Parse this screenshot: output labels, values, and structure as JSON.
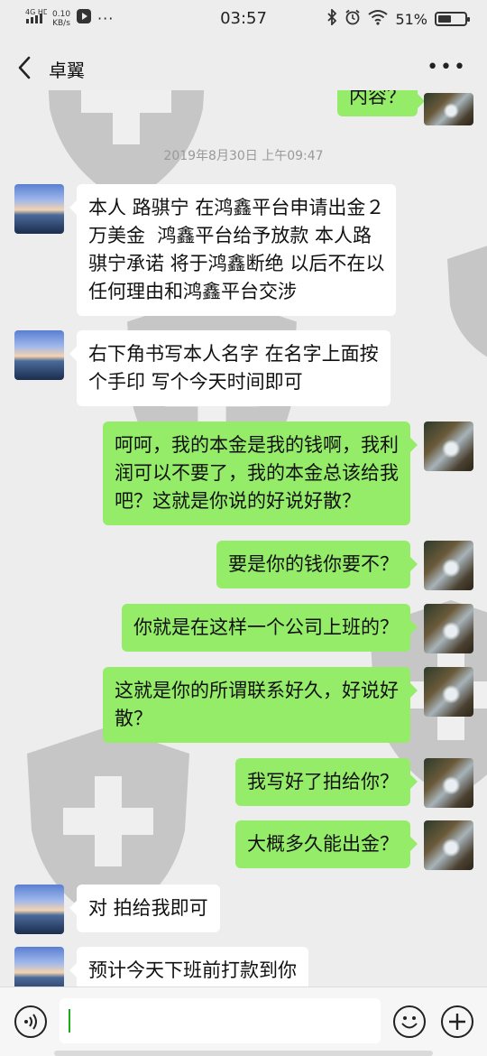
{
  "status_bar": {
    "network": "4G HD",
    "speed_value": "0.10",
    "speed_unit": "KB/s",
    "time": "03:57",
    "battery_text": "51%",
    "battery_level": 0.51
  },
  "header": {
    "title": "卓翼",
    "back_icon": "back-chevron-icon",
    "more_icon": "more-dots-icon"
  },
  "chat": {
    "partial_top_message": "内容？",
    "timestamp": "2019年8月30日 上午09:47",
    "messages": [
      {
        "side": "in",
        "lines": [
          "本人 路骐宁 在鸿鑫平台申请出金２",
          "万美金  鸿鑫平台给予放款 本人路",
          "骐宁承诺 将于鸿鑫断绝 以后不在以",
          "任何理由和鸿鑫平台交涉"
        ]
      },
      {
        "side": "in",
        "lines": [
          "右下角书写本人名字 在名字上面按",
          "个手印 写个今天时间即可"
        ]
      },
      {
        "side": "out",
        "lines": [
          "呵呵，我的本金是我的钱啊，我利",
          "润可以不要了，我的本金总该给我",
          "吧？这就是你说的好说好散？"
        ]
      },
      {
        "side": "out",
        "lines": [
          "要是你的钱你要不？"
        ]
      },
      {
        "side": "out",
        "lines": [
          "你就是在这样一个公司上班的？"
        ]
      },
      {
        "side": "out",
        "lines": [
          "这就是你的所谓联系好久，好说好",
          "散？"
        ]
      },
      {
        "side": "out",
        "lines": [
          "我写好了拍给你？"
        ]
      },
      {
        "side": "out",
        "lines": [
          "大概多久能出金？"
        ]
      },
      {
        "side": "in",
        "lines": [
          "对 拍给我即可"
        ]
      },
      {
        "side": "in",
        "lines": [
          "预计今天下班前打款到你"
        ]
      }
    ]
  },
  "input_bar": {
    "voice_icon": "voice-icon",
    "emoji_icon": "emoji-icon",
    "plus_icon": "plus-icon",
    "text_value": ""
  },
  "colors": {
    "background": "#ededed",
    "bubble_out": "#95ec69",
    "bubble_in": "#ffffff",
    "timestamp": "#999999"
  }
}
